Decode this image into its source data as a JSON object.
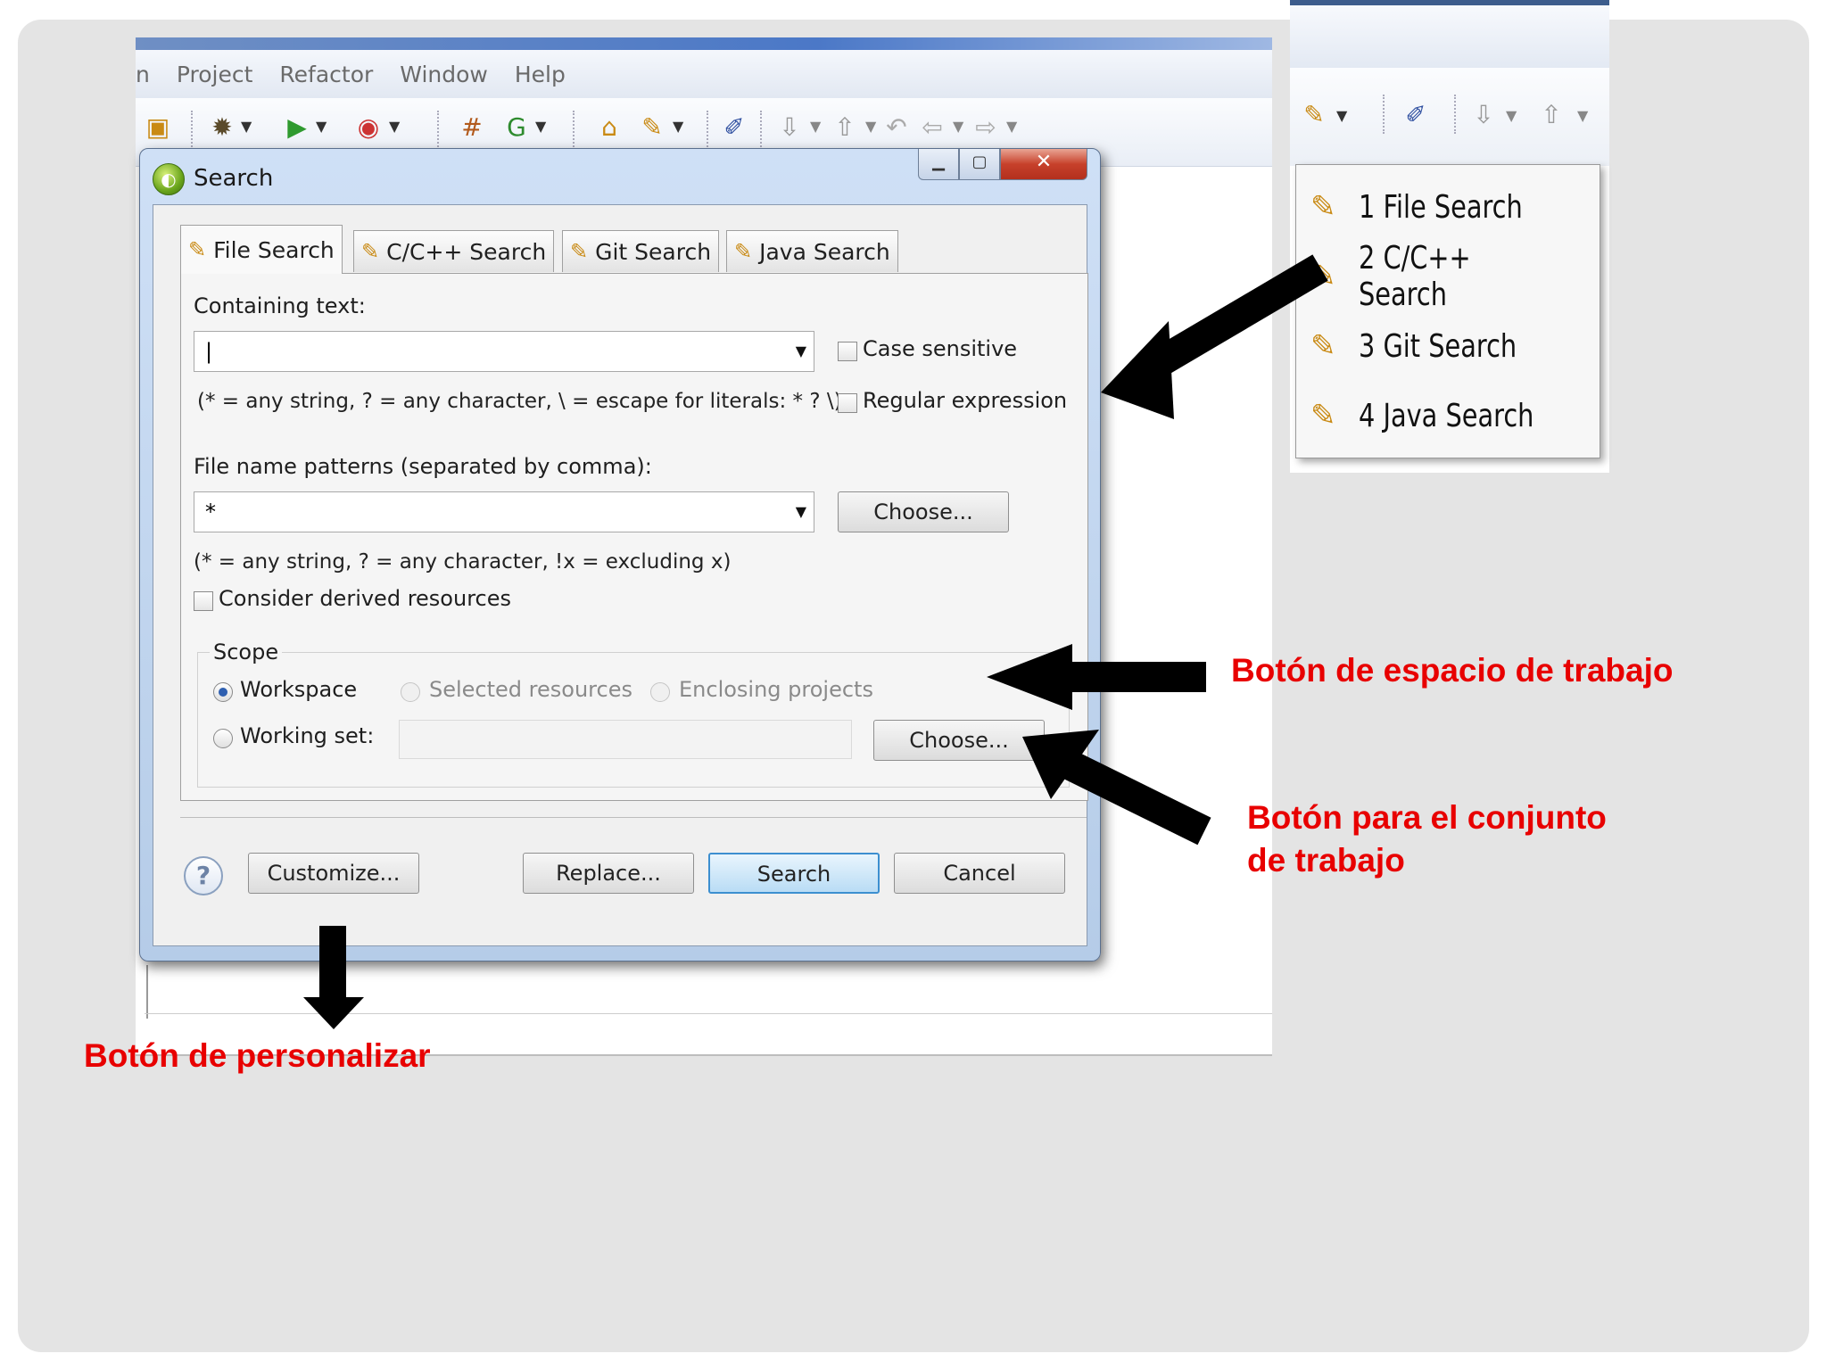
{
  "menubar": {
    "items": [
      "n",
      "Project",
      "Refactor",
      "Window",
      "Help"
    ]
  },
  "dialog": {
    "title": "Search",
    "tabs": [
      "File Search",
      "C/C++ Search",
      "Git Search",
      "Java Search"
    ],
    "containing_text_label": "Containing text:",
    "containing_text_value": "|",
    "case_sensitive": "Case sensitive",
    "regex_hint": "(* = any string, ? = any character, \\ = escape for literals: * ? \\)",
    "regular_expression": "Regular expression",
    "file_patterns_label": "File name patterns (separated by comma):",
    "file_patterns_value": "*",
    "choose_label": "Choose...",
    "pattern_hint": "(* = any string, ? = any character, !x = excluding x)",
    "consider_derived": "Consider derived resources",
    "scope_label": "Scope",
    "scope_options": [
      "Workspace",
      "Selected resources",
      "Enclosing projects"
    ],
    "working_set_label": "Working set:",
    "working_set_choose": "Choose...",
    "help_symbol": "?",
    "buttons": {
      "customize": "Customize...",
      "replace": "Replace...",
      "search": "Search",
      "cancel": "Cancel"
    }
  },
  "search_menu": {
    "items": [
      "1 File Search",
      "2 C/C++ Search",
      "3 Git Search",
      "4 Java Search"
    ]
  },
  "annotations": {
    "workspace": "Botón de espacio de trabajo",
    "working_set": "Botón para el conjunto de trabajo",
    "customize": "Botón de personalizar"
  },
  "colors": {
    "annotation": "#e80000",
    "slide_bg": "#e4e4e4"
  }
}
